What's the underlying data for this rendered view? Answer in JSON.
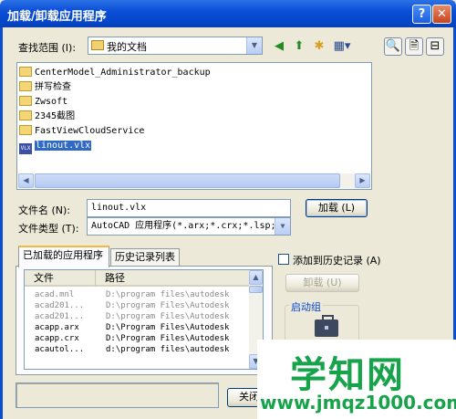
{
  "window": {
    "title": "加载/卸载应用程序",
    "help_glyph": "?",
    "close_glyph": "✕"
  },
  "lookin": {
    "label": "查找范围 (I):",
    "value": "我的文档"
  },
  "toolbar": {
    "back_glyph": "◀",
    "up_glyph": "⬆",
    "newfolder_glyph": "✱",
    "views_glyph": "▦▾",
    "find_glyph": "🔍",
    "search_glyph": "🗎",
    "options_glyph": "⊟"
  },
  "files": [
    {
      "name": "CenterModel_Administrator_backup",
      "kind": "folder"
    },
    {
      "name": "拼写检查",
      "kind": "folder"
    },
    {
      "name": "Zwsoft",
      "kind": "folder"
    },
    {
      "name": "2345截图",
      "kind": "folder"
    },
    {
      "name": "FastViewCloudService",
      "kind": "folder"
    },
    {
      "name": "linout.vlx",
      "kind": "vlx",
      "selected": true
    }
  ],
  "vlx_icon_text": "VLX",
  "filename": {
    "label": "文件名 (N):",
    "value": "linout.vlx"
  },
  "filetype": {
    "label": "文件类型 (T):",
    "value": "AutoCAD 应用程序(*.arx;*.crx;*.lsp;*"
  },
  "load_button": "加载 (L)",
  "tabs": {
    "loaded": "已加载的应用程序",
    "history": "历史记录列表"
  },
  "applist": {
    "col_file": "文件",
    "col_path": "路径",
    "rows": [
      {
        "file": "acad.mnl",
        "path": "D:\\program files\\autodesk",
        "grey": true
      },
      {
        "file": "acad201...",
        "path": "D:\\program Files\\Autodesk",
        "grey": true
      },
      {
        "file": "acad201...",
        "path": "D:\\program Files\\Autodesk",
        "grey": true
      },
      {
        "file": "acapp.arx",
        "path": "D:\\Program Files\\Autodesk",
        "grey": false
      },
      {
        "file": "acapp.crx",
        "path": "D:\\Program Files\\Autodesk",
        "grey": false
      },
      {
        "file": "acautol...",
        "path": "d:\\program files\\autodesk",
        "grey": false
      }
    ]
  },
  "add_history": {
    "label": "添加到历史记录 (A)",
    "checked": false
  },
  "unload_button": "卸载 (U)",
  "startup_group": "启动组",
  "close_button": "关闭",
  "watermark": {
    "logo": "学知网",
    "url": "www.jmqz1000.com"
  }
}
